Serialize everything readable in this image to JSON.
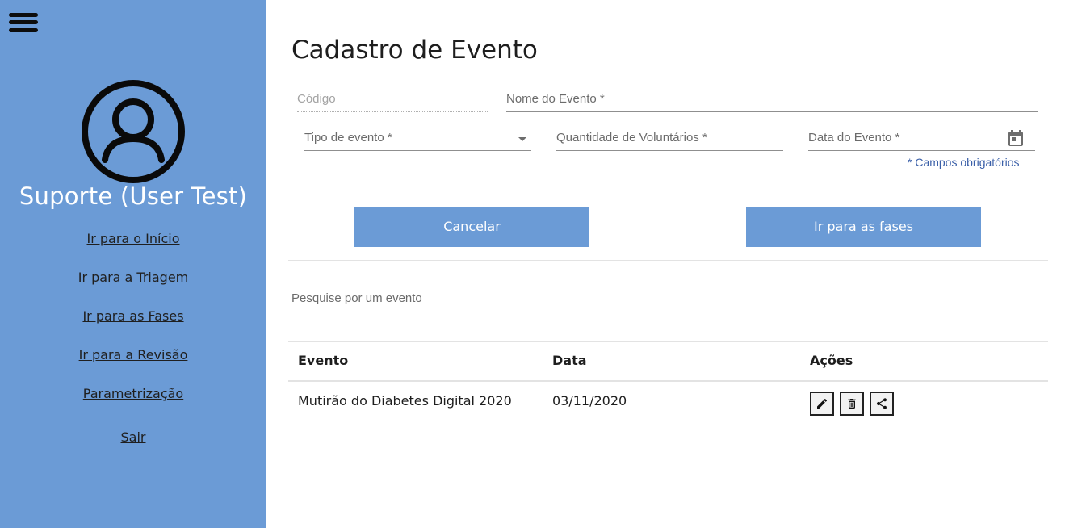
{
  "sidebar": {
    "user_name": "Suporte (User Test)",
    "links": [
      {
        "label": "Ir para o Início"
      },
      {
        "label": "Ir para a Triagem"
      },
      {
        "label": "Ir para as Fases"
      },
      {
        "label": "Ir para a Revisão"
      },
      {
        "label": "Parametrização"
      },
      {
        "label": "Sair"
      }
    ],
    "bg_color": "#6b9bd6"
  },
  "page": {
    "title": "Cadastro de Evento"
  },
  "form": {
    "codigo_placeholder": "Código",
    "nome_placeholder": "Nome do Evento *",
    "tipo_placeholder": "Tipo de evento *",
    "quantidade_placeholder": "Quantidade de Voluntários *",
    "data_placeholder": "Data do Evento *",
    "required_note": "* Campos obrigatórios",
    "cancel_label": "Cancelar",
    "next_label": "Ir para as fases"
  },
  "search": {
    "placeholder": "Pesquise por um evento"
  },
  "table": {
    "headers": [
      "Evento",
      "Data",
      "Ações"
    ],
    "rows": [
      {
        "evento": "Mutirão do Diabetes Digital 2020",
        "data": "03/11/2020",
        "actions": [
          "pencil-icon",
          "trash-icon",
          "share-icon"
        ]
      }
    ]
  },
  "colors": {
    "accent": "#6b9bd6",
    "link_note": "#3a5fa8"
  }
}
